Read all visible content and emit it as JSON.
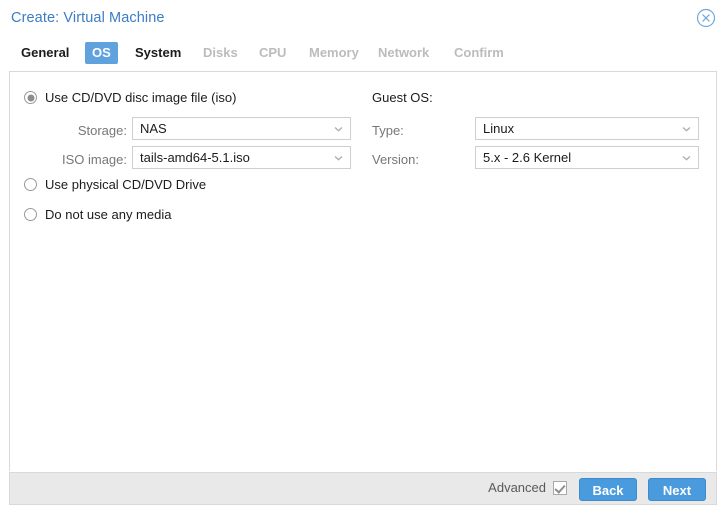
{
  "window": {
    "title": "Create: Virtual Machine",
    "close_icon": "close-circle-icon"
  },
  "tabs": [
    {
      "label": "General",
      "state": "enabled"
    },
    {
      "label": "OS",
      "state": "active"
    },
    {
      "label": "System",
      "state": "enabled"
    },
    {
      "label": "Disks",
      "state": "disabled"
    },
    {
      "label": "CPU",
      "state": "disabled"
    },
    {
      "label": "Memory",
      "state": "disabled"
    },
    {
      "label": "Network",
      "state": "disabled"
    },
    {
      "label": "Confirm",
      "state": "disabled"
    }
  ],
  "media": {
    "options": [
      {
        "label": "Use CD/DVD disc image file (iso)",
        "selected": true
      },
      {
        "label": "Use physical CD/DVD Drive",
        "selected": false
      },
      {
        "label": "Do not use any media",
        "selected": false
      }
    ],
    "storage_label": "Storage:",
    "storage_value": "NAS",
    "iso_label": "ISO image:",
    "iso_value": "tails-amd64-5.1.iso"
  },
  "guest_os": {
    "heading": "Guest OS:",
    "type_label": "Type:",
    "type_value": "Linux",
    "version_label": "Version:",
    "version_value": "5.x - 2.6 Kernel"
  },
  "footer": {
    "advanced_label": "Advanced",
    "advanced_checked": true,
    "back_label": "Back",
    "next_label": "Next"
  },
  "icons": {
    "chevron_down": "chevron-down-icon"
  },
  "colors": {
    "title_blue": "#3b7cc4",
    "tab_active_bg": "#5fa2dd",
    "button_blue": "#4a9ade",
    "disabled_text": "#bcbcbc",
    "footer_bg": "#e9e9e9"
  }
}
